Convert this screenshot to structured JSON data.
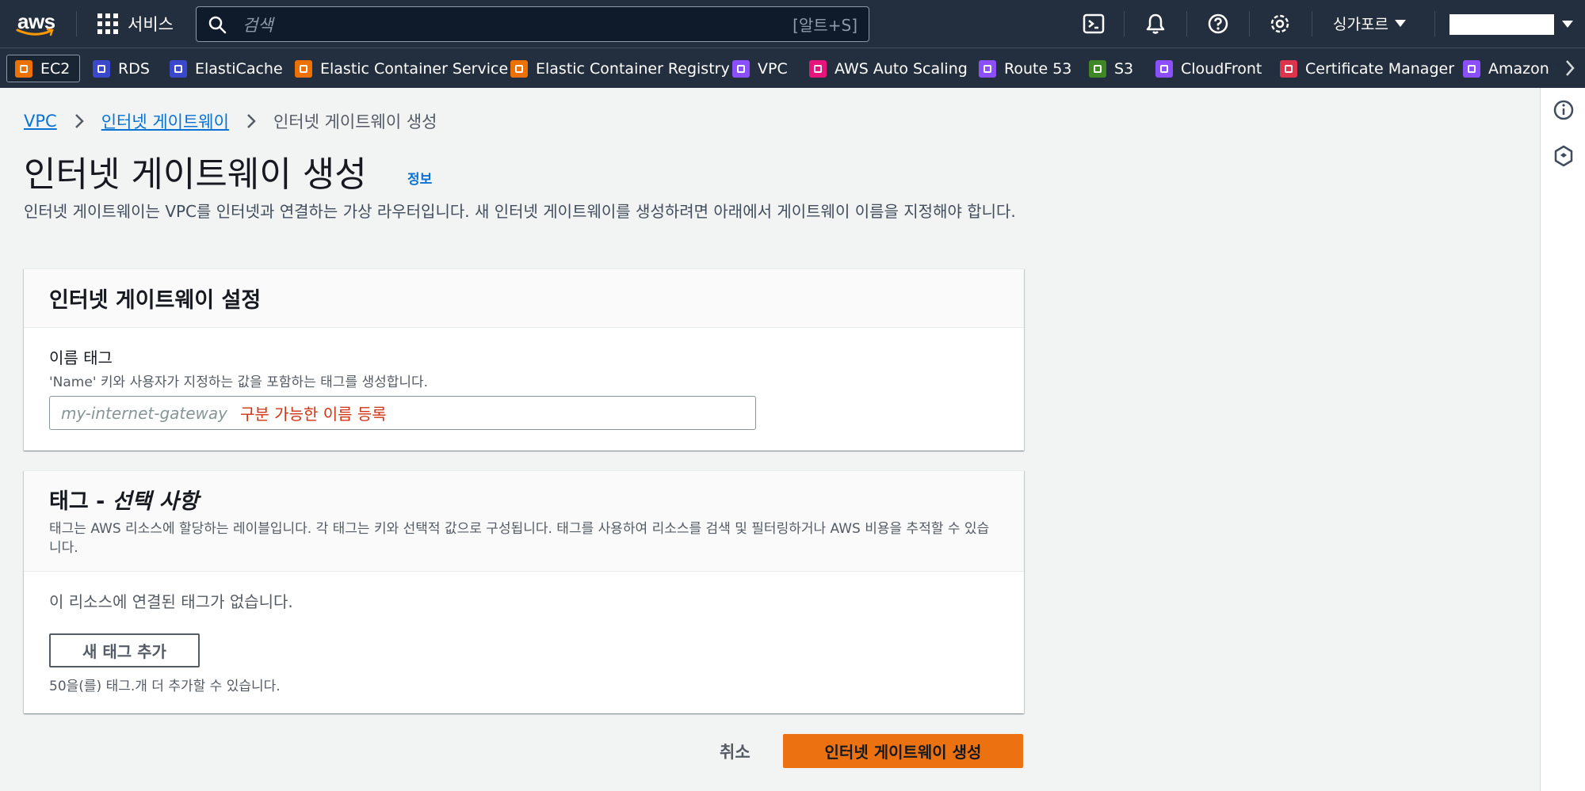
{
  "topnav": {
    "logo_text": "aws",
    "services_label": "서비스",
    "search_placeholder": "검색",
    "search_shortcut": "[알트+S]",
    "region": "싱가포르",
    "icons": [
      "cloudshell-icon",
      "bell-icon",
      "help-icon",
      "gear-icon"
    ]
  },
  "favorites": [
    {
      "label": "EC2",
      "color": "#ed7100"
    },
    {
      "label": "RDS",
      "color": "#3b48cc"
    },
    {
      "label": "ElastiCache",
      "color": "#3b48cc"
    },
    {
      "label": "Elastic Container Service",
      "color": "#ed7100"
    },
    {
      "label": "Elastic Container Registry",
      "color": "#ed7100"
    },
    {
      "label": "VPC",
      "color": "#8c4fff"
    },
    {
      "label": "AWS Auto Scaling",
      "color": "#e7157b"
    },
    {
      "label": "Route 53",
      "color": "#8c4fff"
    },
    {
      "label": "S3",
      "color": "#3f8624"
    },
    {
      "label": "CloudFront",
      "color": "#8c4fff"
    },
    {
      "label": "Certificate Manager",
      "color": "#dd344c"
    },
    {
      "label": "Amazon C",
      "color": "#8c4fff"
    }
  ],
  "breadcrumb": {
    "vpc": "VPC",
    "igw": "인터넷 게이트웨이",
    "current": "인터넷 게이트웨이 생성"
  },
  "page": {
    "title": "인터넷 게이트웨이 생성",
    "info": "정보",
    "description": "인터넷 게이트웨이는 VPC를 인터넷과 연결하는 가상 라우터입니다. 새 인터넷 게이트웨이를 생성하려면 아래에서 게이트웨이 이름을 지정해야 합니다."
  },
  "settings": {
    "header": "인터넷 게이트웨이 설정",
    "name_label": "이름 태그",
    "name_hint": "'Name' 키와 사용자가 지정하는 값을 포함하는 태그를 생성합니다.",
    "name_placeholder": "my-internet-gateway",
    "name_annotation": "구분 가능한 이름 등록"
  },
  "tags": {
    "header_prefix": "태그 - ",
    "header_optional": "선택 사항",
    "description": "태그는 AWS 리소스에 할당하는 레이블입니다. 각 태그는 키와 선택적 값으로 구성됩니다. 태그를 사용하여 리소스를 검색 및 필터링하거나 AWS 비용을 추적할 수 있습니다.",
    "empty": "이 리소스에 연결된 태그가 없습니다.",
    "add_button": "새 태그 추가",
    "limit": "50을(를) 태그.개 더 추가할 수 있습니다."
  },
  "actions": {
    "cancel": "취소",
    "submit": "인터넷 게이트웨이 생성"
  }
}
